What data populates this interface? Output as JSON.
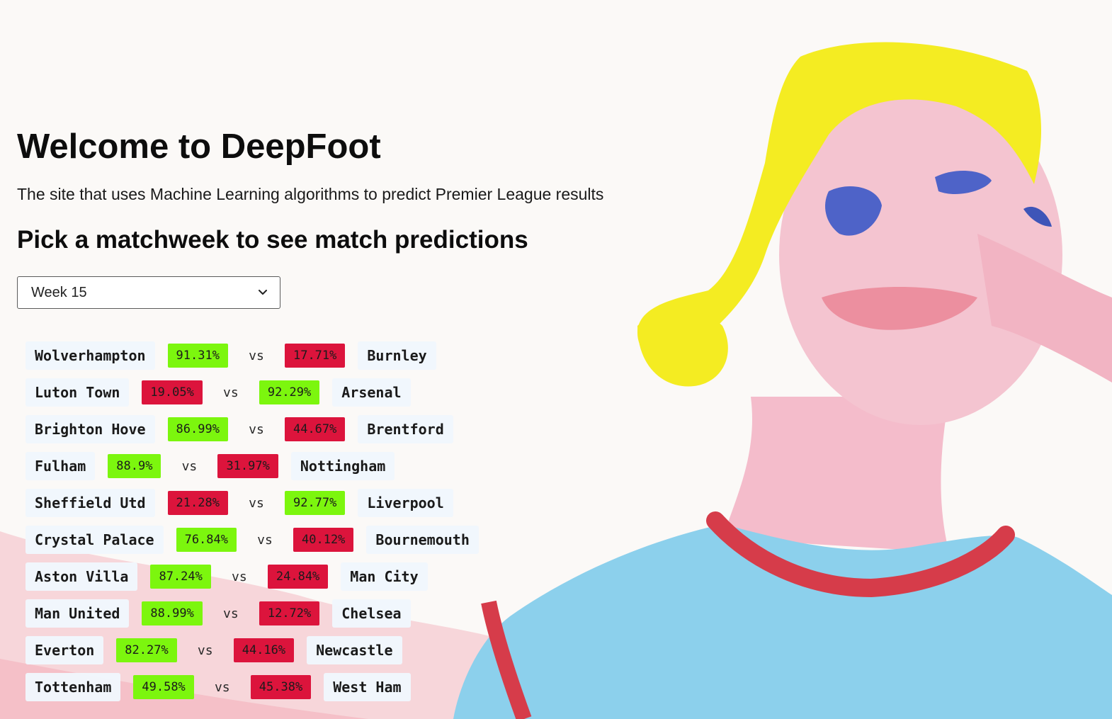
{
  "header": {
    "title": "Welcome to DeepFoot",
    "subtitle": "The site that uses Machine Learning algorithms to predict Premier League results",
    "prompt": "Pick a matchweek to see match predictions"
  },
  "matchweek_select": {
    "selected": "Week 15",
    "icon": "chevron-down-icon"
  },
  "colors": {
    "win": "#7cf60e",
    "lose": "#dc143c"
  },
  "vs_label": "vs",
  "matches": [
    {
      "home": "Wolverhampton",
      "home_pct": "91.31%",
      "home_result": "win",
      "away": "Burnley",
      "away_pct": "17.71%",
      "away_result": "lose"
    },
    {
      "home": "Luton Town",
      "home_pct": "19.05%",
      "home_result": "lose",
      "away": "Arsenal",
      "away_pct": "92.29%",
      "away_result": "win"
    },
    {
      "home": "Brighton Hove",
      "home_pct": "86.99%",
      "home_result": "win",
      "away": "Brentford",
      "away_pct": "44.67%",
      "away_result": "lose"
    },
    {
      "home": "Fulham",
      "home_pct": "88.9%",
      "home_result": "win",
      "away": "Nottingham",
      "away_pct": "31.97%",
      "away_result": "lose"
    },
    {
      "home": "Sheffield Utd",
      "home_pct": "21.28%",
      "home_result": "lose",
      "away": "Liverpool",
      "away_pct": "92.77%",
      "away_result": "win"
    },
    {
      "home": "Crystal Palace",
      "home_pct": "76.84%",
      "home_result": "win",
      "away": "Bournemouth",
      "away_pct": "40.12%",
      "away_result": "lose"
    },
    {
      "home": "Aston Villa",
      "home_pct": "87.24%",
      "home_result": "win",
      "away": "Man City",
      "away_pct": "24.84%",
      "away_result": "lose"
    },
    {
      "home": "Man United",
      "home_pct": "88.99%",
      "home_result": "win",
      "away": "Chelsea",
      "away_pct": "12.72%",
      "away_result": "lose"
    },
    {
      "home": "Everton",
      "home_pct": "82.27%",
      "home_result": "win",
      "away": "Newcastle",
      "away_pct": "44.16%",
      "away_result": "lose"
    },
    {
      "home": "Tottenham",
      "home_pct": "49.58%",
      "home_result": "win",
      "away": "West Ham",
      "away_pct": "45.38%",
      "away_result": "lose"
    }
  ]
}
